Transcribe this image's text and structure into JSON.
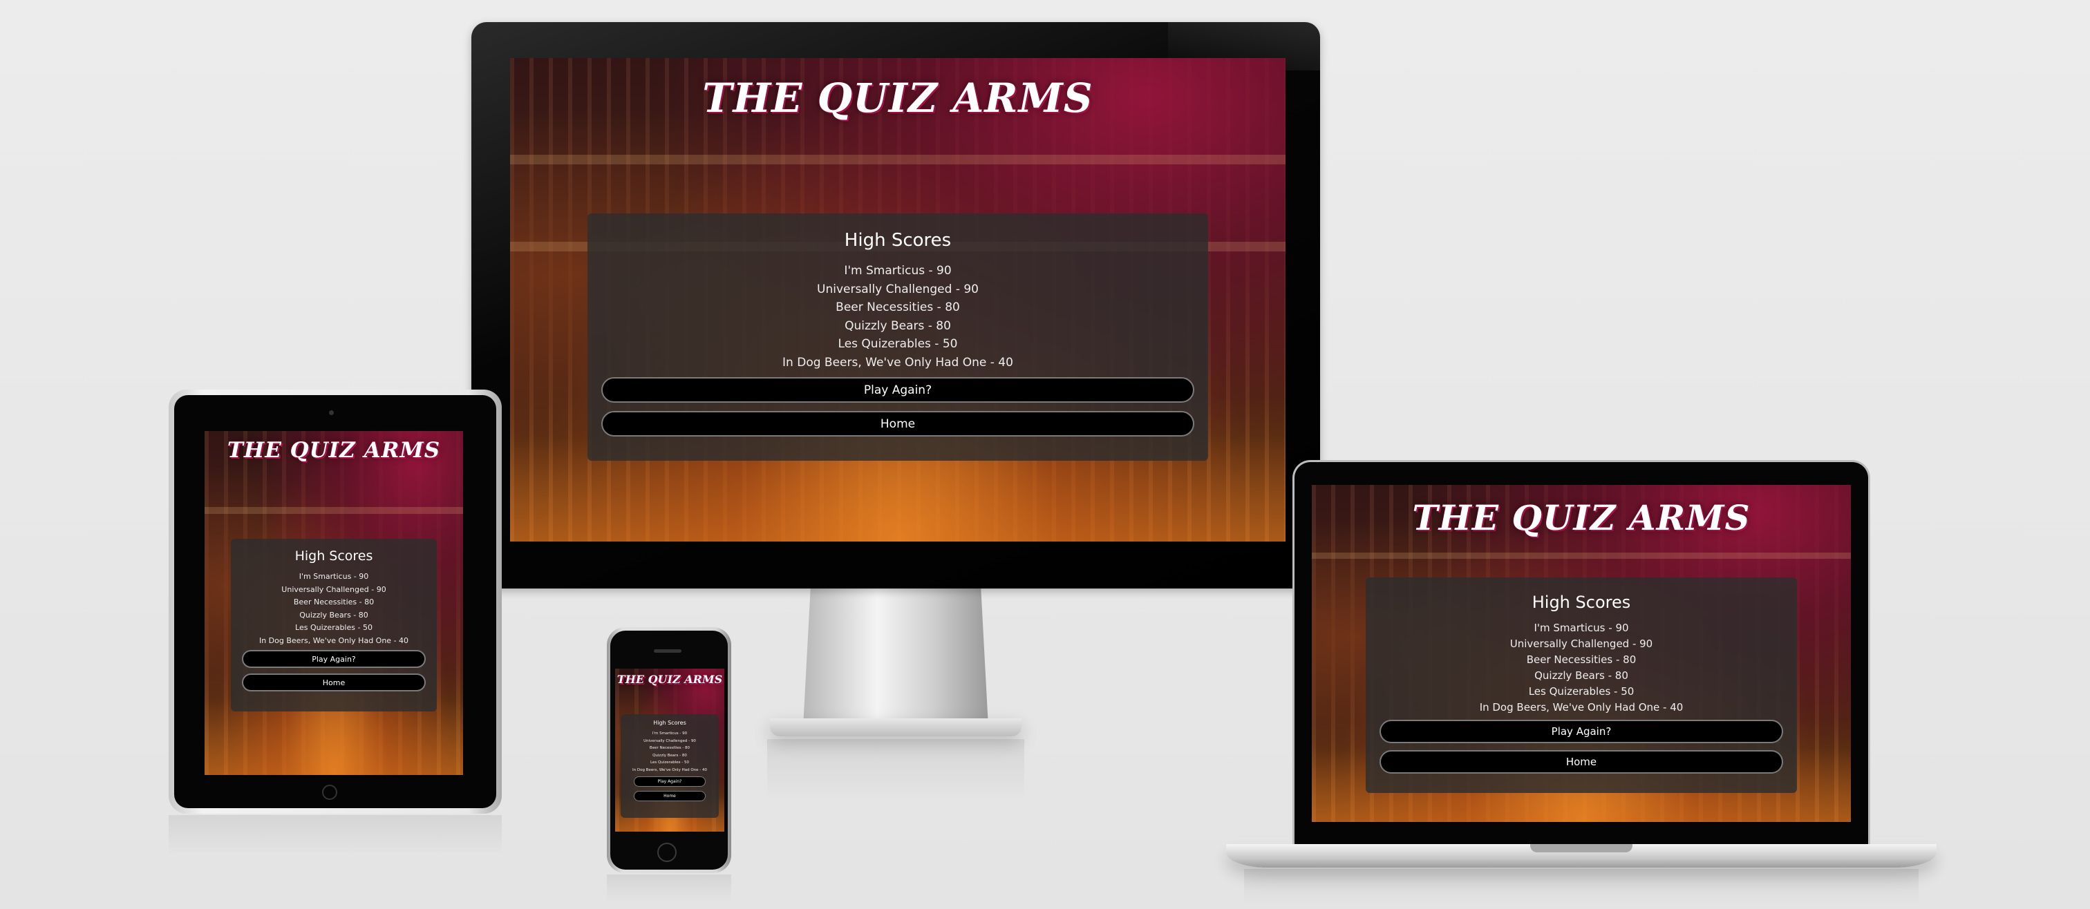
{
  "site": {
    "title": "THE QUIZ ARMS",
    "accent_color": "#b0104a"
  },
  "high_scores": {
    "heading": "High Scores",
    "entries": [
      {
        "text": "I'm Smarticus - 90"
      },
      {
        "text": "Universally Challenged - 90"
      },
      {
        "text": "Beer Necessities - 80"
      },
      {
        "text": "Quizzly Bears - 80"
      },
      {
        "text": "Les Quizerables - 50"
      },
      {
        "text": "In Dog Beers, We've Only Had One - 40"
      }
    ]
  },
  "buttons": {
    "play_again": "Play Again?",
    "home": "Home"
  },
  "devices": [
    "desktop-monitor",
    "tablet",
    "phone",
    "laptop"
  ]
}
